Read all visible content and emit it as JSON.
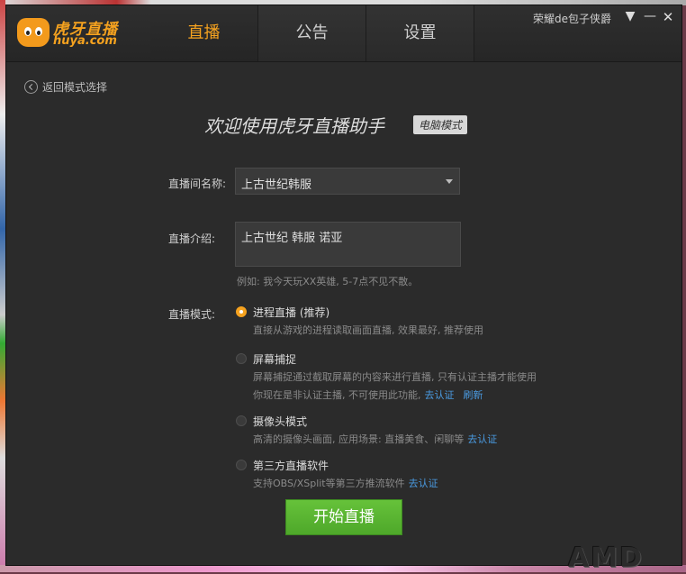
{
  "logo": {
    "cn": "虎牙直播",
    "en": "huya.com"
  },
  "nav": {
    "tabs": [
      {
        "label": "直播",
        "active": true
      },
      {
        "label": "公告",
        "active": false
      },
      {
        "label": "设置",
        "active": false
      }
    ]
  },
  "user": {
    "name": "荣耀de包子侠爵"
  },
  "window_controls": {
    "menu": "▼",
    "minimize": "—",
    "close": "✕"
  },
  "back": {
    "label": "返回模式选择"
  },
  "headline": {
    "title": "欢迎使用虎牙直播助手",
    "badge": "电脑模式"
  },
  "form": {
    "room_name_label": "直播间名称:",
    "room_name_value": "上古世纪韩服",
    "intro_label": "直播介绍:",
    "intro_value": "上古世纪 韩服 诺亚",
    "intro_hint": "例如: 我今天玩XX英雄, 5-7点不见不散。",
    "mode_label": "直播模式:"
  },
  "modes": [
    {
      "title": "进程直播 (推荐)",
      "checked": true,
      "desc": [
        "直接从游戏的进程读取画面直播, 效果最好, 推荐使用"
      ]
    },
    {
      "title": "屏幕捕捉",
      "checked": false,
      "desc": [
        "屏幕捕捉通过截取屏幕的内容来进行直播, 只有认证主播才能使用",
        "你现在是非认证主播, 不可使用此功能,"
      ],
      "links": [
        "去认证",
        "刷新"
      ]
    },
    {
      "title": "摄像头模式",
      "checked": false,
      "desc": [
        "高清的摄像头画面, 应用场景: 直播美食、闲聊等"
      ],
      "links": [
        "去认证"
      ]
    },
    {
      "title": "第三方直播软件",
      "checked": false,
      "desc": [
        "支持OBS/XSplit等第三方推流软件"
      ],
      "links": [
        "去认证"
      ]
    }
  ],
  "start_button": "开始直播",
  "watermark": "AMD",
  "colors": {
    "accent": "#f5a21f",
    "start_button": "#5cb832",
    "link": "#4a9ae0",
    "window_bg": "#2b2b2b"
  }
}
